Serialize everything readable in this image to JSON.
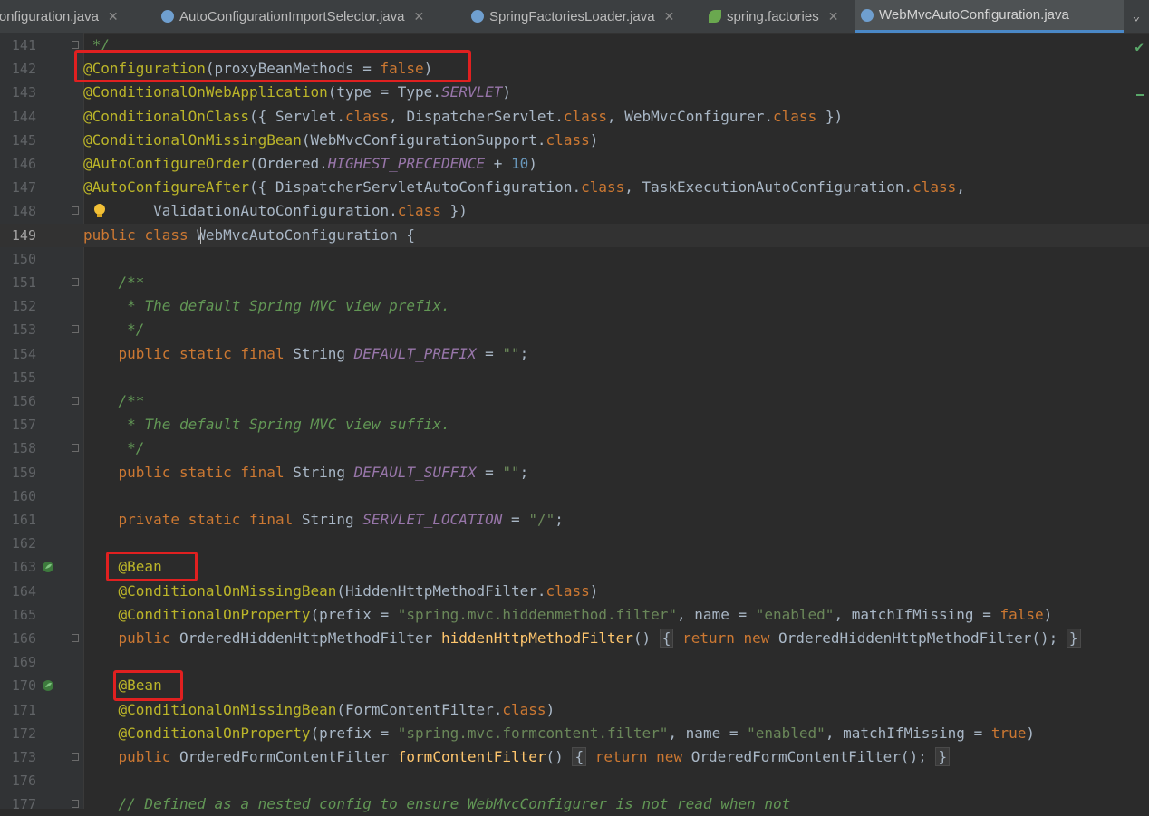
{
  "tabs": [
    {
      "label": "Configuration.java",
      "icon": "java-class-icon",
      "closable": true,
      "active": false
    },
    {
      "label": "AutoConfigurationImportSelector.java",
      "icon": "java-class-icon",
      "closable": true,
      "active": false
    },
    {
      "label": "SpringFactoriesLoader.java",
      "icon": "java-class-icon",
      "closable": true,
      "active": false
    },
    {
      "label": "spring.factories",
      "icon": "spring-leaf-icon",
      "closable": true,
      "active": false
    },
    {
      "label": "WebMvcAutoConfiguration.java",
      "icon": "java-class-icon",
      "closable": true,
      "active": true
    }
  ],
  "tab_close_glyph": "✕",
  "tab_dropdown_glyph": "⌄",
  "current_line": "149",
  "lines": [
    {
      "n": "141",
      "text": " */"
    },
    {
      "n": "142",
      "text": "@Configuration(proxyBeanMethods = false)"
    },
    {
      "n": "143",
      "text": "@ConditionalOnWebApplication(type = Type.SERVLET)"
    },
    {
      "n": "144",
      "text": "@ConditionalOnClass({ Servlet.class, DispatcherServlet.class, WebMvcConfigurer.class })"
    },
    {
      "n": "145",
      "text": "@ConditionalOnMissingBean(WebMvcConfigurationSupport.class)"
    },
    {
      "n": "146",
      "text": "@AutoConfigureOrder(Ordered.HIGHEST_PRECEDENCE + 10)"
    },
    {
      "n": "147",
      "text": "@AutoConfigureAfter({ DispatcherServletAutoConfiguration.class, TaskExecutionAutoConfiguration.class,"
    },
    {
      "n": "148",
      "text": "        ValidationAutoConfiguration.class })"
    },
    {
      "n": "149",
      "text": "public class WebMvcAutoConfiguration {"
    },
    {
      "n": "150",
      "text": ""
    },
    {
      "n": "151",
      "text": "    /**"
    },
    {
      "n": "152",
      "text": "     * The default Spring MVC view prefix."
    },
    {
      "n": "153",
      "text": "     */"
    },
    {
      "n": "154",
      "text": "    public static final String DEFAULT_PREFIX = \"\";"
    },
    {
      "n": "155",
      "text": ""
    },
    {
      "n": "156",
      "text": "    /**"
    },
    {
      "n": "157",
      "text": "     * The default Spring MVC view suffix."
    },
    {
      "n": "158",
      "text": "     */"
    },
    {
      "n": "159",
      "text": "    public static final String DEFAULT_SUFFIX = \"\";"
    },
    {
      "n": "160",
      "text": ""
    },
    {
      "n": "161",
      "text": "    private static final String SERVLET_LOCATION = \"/\";"
    },
    {
      "n": "162",
      "text": ""
    },
    {
      "n": "163",
      "text": "    @Bean"
    },
    {
      "n": "164",
      "text": "    @ConditionalOnMissingBean(HiddenHttpMethodFilter.class)"
    },
    {
      "n": "165",
      "text": "    @ConditionalOnProperty(prefix = \"spring.mvc.hiddenmethod.filter\", name = \"enabled\", matchIfMissing = false)"
    },
    {
      "n": "166",
      "text": "    public OrderedHiddenHttpMethodFilter hiddenHttpMethodFilter() { return new OrderedHiddenHttpMethodFilter(); }"
    },
    {
      "n": "169",
      "text": ""
    },
    {
      "n": "170",
      "text": "    @Bean"
    },
    {
      "n": "171",
      "text": "    @ConditionalOnMissingBean(FormContentFilter.class)"
    },
    {
      "n": "172",
      "text": "    @ConditionalOnProperty(prefix = \"spring.mvc.formcontent.filter\", name = \"enabled\", matchIfMissing = true)"
    },
    {
      "n": "173",
      "text": "    public OrderedFormContentFilter formContentFilter() { return new OrderedFormContentFilter(); }"
    },
    {
      "n": "176",
      "text": ""
    },
    {
      "n": "177",
      "text": "    // Defined as a nested config to ensure WebMvcConfigurer is not read when not"
    }
  ],
  "colors": {
    "annotation": "#bbb529",
    "keyword": "#cc7832",
    "string": "#6a8759",
    "number": "#6897bb",
    "comment": "#629755",
    "constant": "#9876aa",
    "method": "#ffc66d",
    "default_text": "#a9b7c6",
    "highlight_box": "#e02020",
    "tab_underline": "#4a88c7"
  },
  "status": {
    "inspection_ok_icon": "checkmark-icon",
    "inspection_glyph": "✔"
  }
}
